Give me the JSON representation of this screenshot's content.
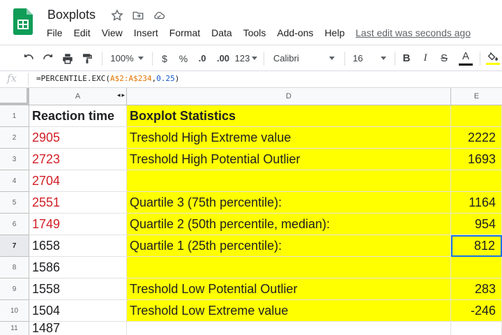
{
  "app": {
    "doc_title": "Boxplots",
    "last_edit": "Last edit was seconds ago",
    "menu": [
      "File",
      "Edit",
      "View",
      "Insert",
      "Format",
      "Data",
      "Tools",
      "Add-ons",
      "Help"
    ]
  },
  "toolbar": {
    "zoom": "100%",
    "currency": "$",
    "percent": "%",
    "decrease_decimals": ".0",
    "increase_decimals": ".00",
    "more_formats": "123",
    "font": "Calibri",
    "font_size": "16",
    "bold": "B",
    "italic": "I",
    "strikethrough": "S",
    "text_color_letter": "A",
    "text_color_swatch": "#000000",
    "fill_color_swatch": "#ffff00"
  },
  "formula_bar": {
    "fx": "fx",
    "formula_prefix": "=PERCENTILE.EXC(",
    "formula_range": "A$2:A$234",
    "formula_comma": ",",
    "formula_arg": "0.25",
    "formula_suffix": ")"
  },
  "columns": {
    "a": "A",
    "d": "D",
    "e": "E"
  },
  "rows": [
    {
      "num": "1",
      "a": "Reaction time",
      "d": "Boxplot Statistics",
      "e": ""
    },
    {
      "num": "2",
      "a": "2905",
      "d": "Treshold High Extreme value",
      "e": "2222"
    },
    {
      "num": "3",
      "a": "2723",
      "d": "Treshold High Potential Outlier",
      "e": "1693"
    },
    {
      "num": "4",
      "a": "2704",
      "d": "",
      "e": ""
    },
    {
      "num": "5",
      "a": "2551",
      "d": "Quartile 3 (75th percentile):",
      "e": "1164"
    },
    {
      "num": "6",
      "a": "1749",
      "d": "Quartile 2 (50th percentile, median):",
      "e": "954"
    },
    {
      "num": "7",
      "a": "1658",
      "d": "Quartile 1 (25th percentile):",
      "e": "812"
    },
    {
      "num": "8",
      "a": "1586",
      "d": "",
      "e": ""
    },
    {
      "num": "9",
      "a": "1558",
      "d": "Treshold Low Potential Outlier",
      "e": "283"
    },
    {
      "num": "10",
      "a": "1504",
      "d": "Treshold Low Extreme value",
      "e": "-246"
    },
    {
      "num": "11",
      "a": "1487",
      "d": "",
      "e": ""
    }
  ],
  "styles": {
    "highlight": "#ffff00",
    "outlier_text": "#d01f26",
    "selection": "#1a73e8",
    "sheets_green": "#0f9d58"
  }
}
